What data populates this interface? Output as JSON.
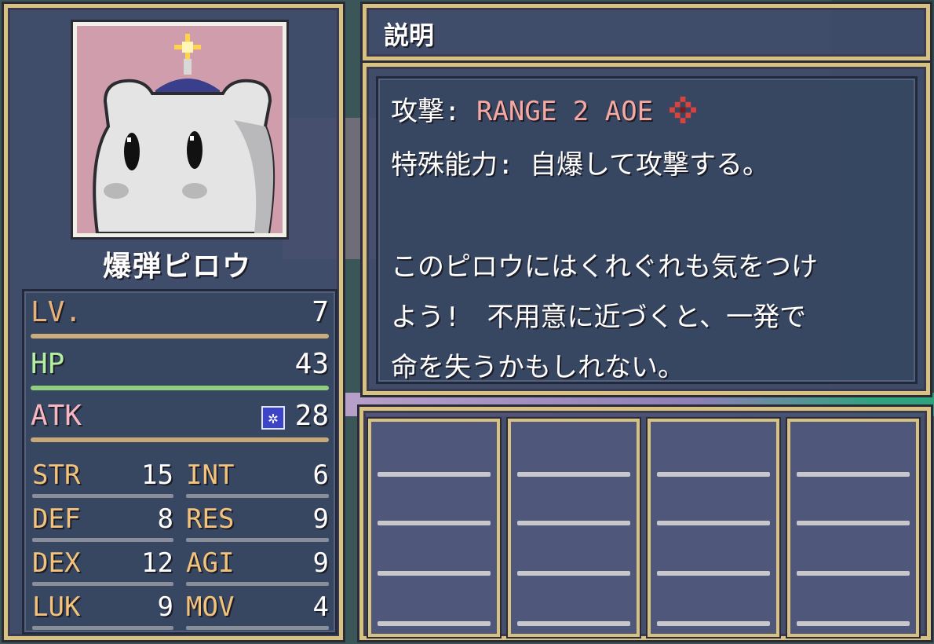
{
  "unit": {
    "name": "爆弾ピロウ",
    "portrait_icon": "bomb-pillow-portrait"
  },
  "stats": {
    "lv": {
      "label": "LV.",
      "value": "7"
    },
    "hp": {
      "label": "HP",
      "value": "43"
    },
    "atk": {
      "label": "ATK",
      "value": "28",
      "icon": "magic-sigil-icon"
    },
    "sub": [
      {
        "label": "STR",
        "value": "15"
      },
      {
        "label": "INT",
        "value": "6"
      },
      {
        "label": "DEF",
        "value": "8"
      },
      {
        "label": "RES",
        "value": "9"
      },
      {
        "label": "DEX",
        "value": "12"
      },
      {
        "label": "AGI",
        "value": "9"
      },
      {
        "label": "LUK",
        "value": "9"
      },
      {
        "label": "MOV",
        "value": "4"
      }
    ]
  },
  "description": {
    "title": "説明",
    "attack_label": "攻撃:",
    "attack_value": "RANGE 2 AOE",
    "attack_icon": "aoe-range-icon",
    "ability_label": "特殊能力:",
    "ability_value": "自爆して攻撃する。",
    "flavor": [
      "このピロウにはくれぐれも気をつけ",
      "よう!　不用意に近づくと、一発で",
      "命を失うかもしれない。"
    ]
  },
  "item_slots": 4,
  "colors": {
    "frame_gold": "#d8c282",
    "panel": "#404a6e",
    "hp_bar": "#8fcf7f",
    "portrait_bg": "#cf9dac"
  }
}
